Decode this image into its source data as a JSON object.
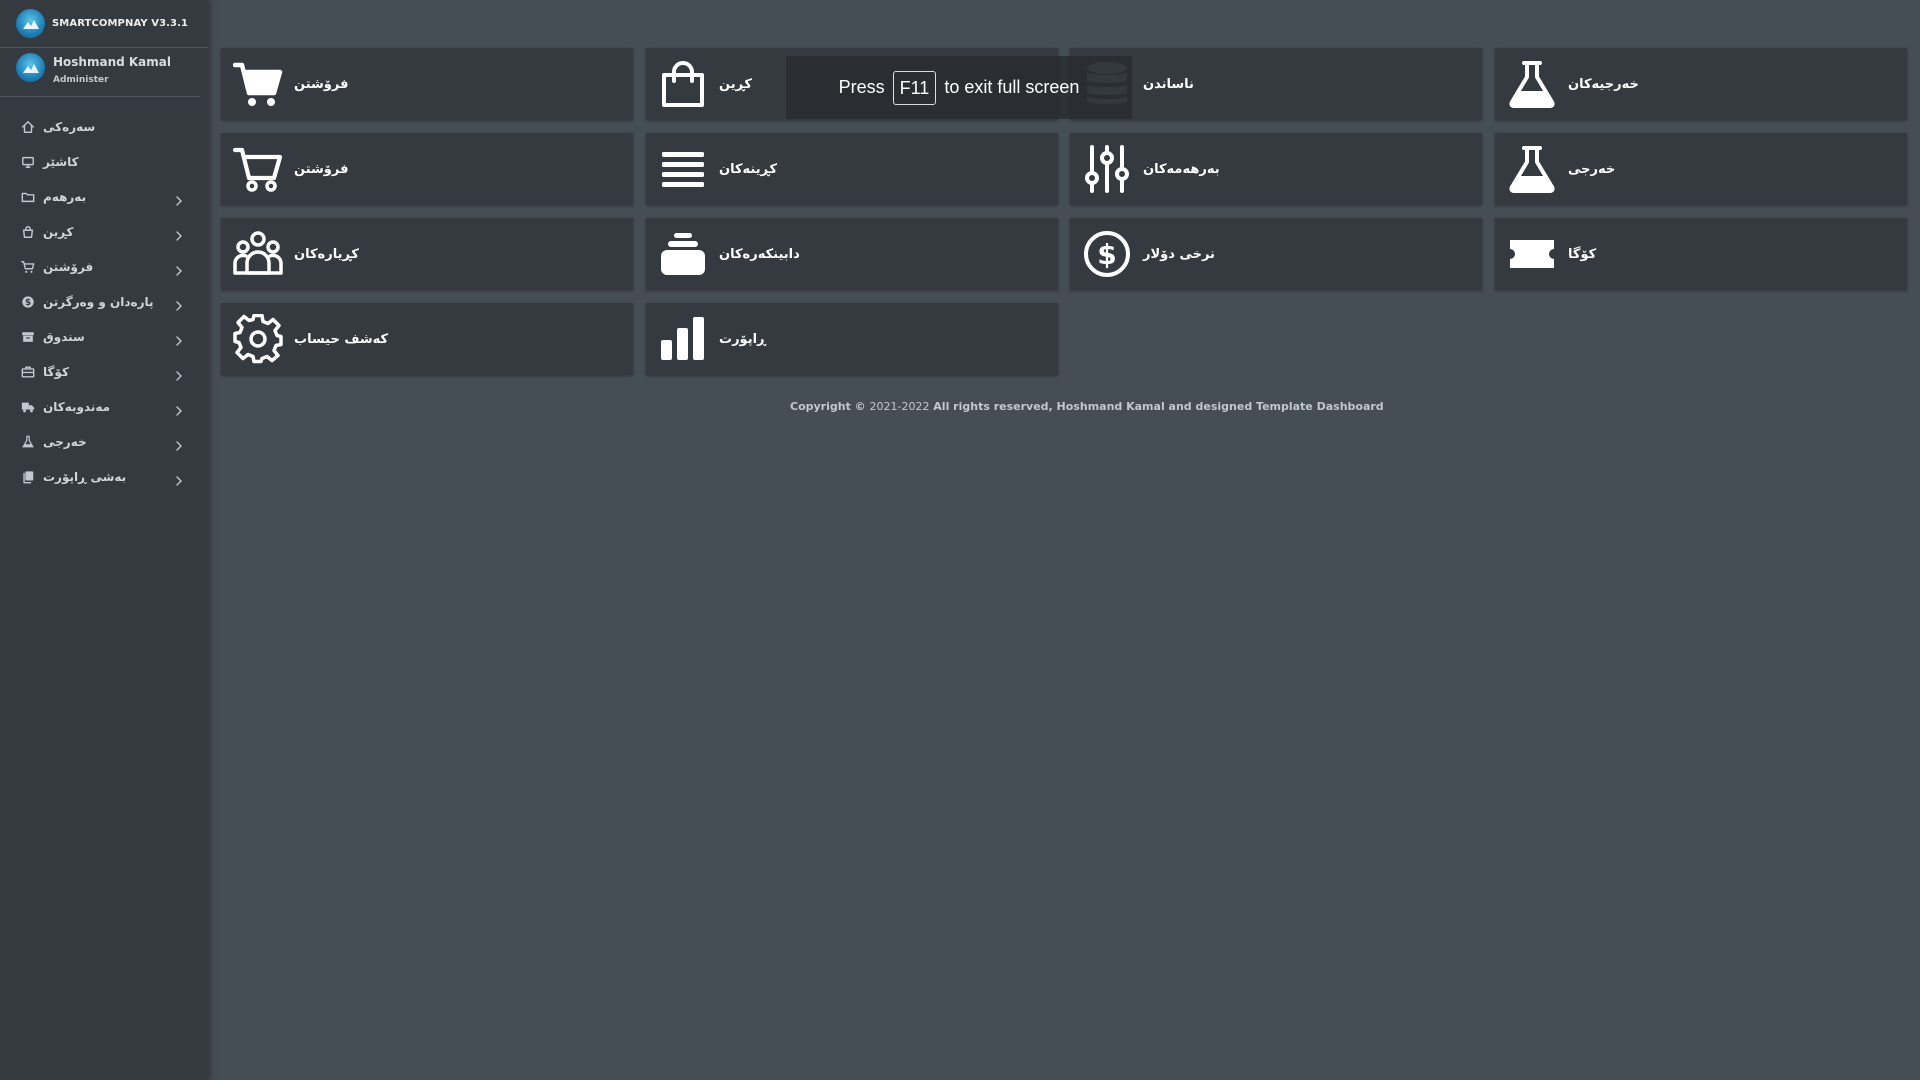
{
  "brand": {
    "name": "SMARTCOMPNAY V3.3.1"
  },
  "user": {
    "name": "Hoshmand Kamal",
    "role": "Administer"
  },
  "sidebar": {
    "items": [
      {
        "label": "سەرەکی",
        "icon": "home-icon",
        "has_arrow": false
      },
      {
        "label": "کاشێر",
        "icon": "monitor-icon",
        "has_arrow": false
      },
      {
        "label": "بەرهەم",
        "icon": "folder-icon",
        "has_arrow": true
      },
      {
        "label": "کڕین",
        "icon": "bag-icon",
        "has_arrow": true
      },
      {
        "label": "فرۆشتن",
        "icon": "cart-icon",
        "has_arrow": true
      },
      {
        "label": "پارەدان و وەرگرتن",
        "icon": "dollar-icon",
        "has_arrow": true
      },
      {
        "label": "سندوق",
        "icon": "archive-icon",
        "has_arrow": true
      },
      {
        "label": "کۆگا",
        "icon": "briefcase-icon",
        "has_arrow": true
      },
      {
        "label": "مەندوبەکان",
        "icon": "truck-icon",
        "has_arrow": true
      },
      {
        "label": "خەرجی",
        "icon": "flask-icon",
        "has_arrow": true
      },
      {
        "label": "بەشی ڕاپۆرت",
        "icon": "copy-icon",
        "has_arrow": true
      }
    ]
  },
  "tiles": [
    {
      "label": "فرۆشتن",
      "icon": "cart-icon"
    },
    {
      "label": "کڕین",
      "icon": "shopping-bag-icon"
    },
    {
      "label": "ناساندن",
      "icon": "database-icon"
    },
    {
      "label": "خەرجیەکان",
      "icon": "flask-icon"
    },
    {
      "label": "فرۆشتن",
      "icon": "cart-outline-icon"
    },
    {
      "label": "کڕینەکان",
      "icon": "list-icon"
    },
    {
      "label": "بەرهەمەکان",
      "icon": "sliders-icon"
    },
    {
      "label": "خەرجی",
      "icon": "flask-icon"
    },
    {
      "label": "کڕیارەکان",
      "icon": "users-icon"
    },
    {
      "label": "دابینکەرەکان",
      "icon": "layers-icon"
    },
    {
      "label": "نرخی دۆلار",
      "icon": "dollar-circle-icon"
    },
    {
      "label": "کۆگا",
      "icon": "ticket-icon"
    },
    {
      "label": "کەشف حیساب",
      "icon": "gear-icon"
    },
    {
      "label": "ڕاپۆرت",
      "icon": "bar-chart-icon"
    }
  ],
  "footer": {
    "prefix": "Copyright © ",
    "years": "2021-2022",
    "suffix": " All rights reserved, Hoshmand Kamal and designed Template Dashboard"
  },
  "fullscreen": {
    "press": "Press",
    "key": "F11",
    "message": "to exit full screen"
  }
}
